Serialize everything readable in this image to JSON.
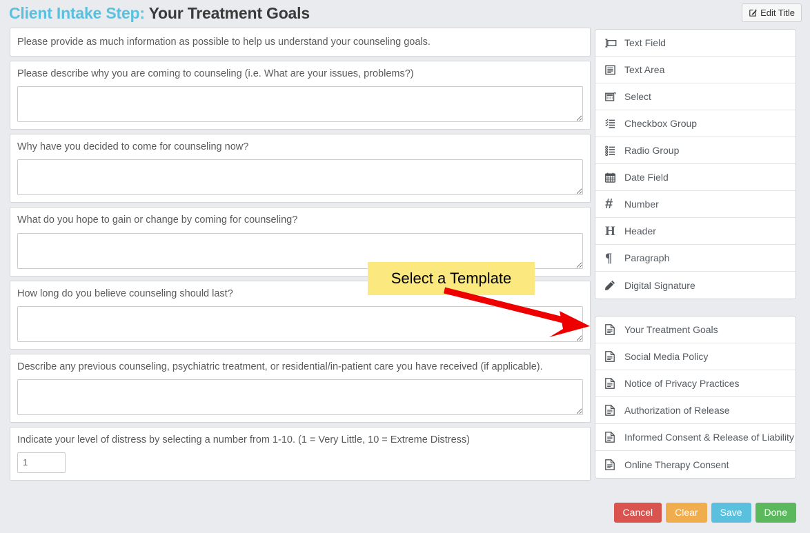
{
  "header": {
    "title_prefix": "Client Intake Step:",
    "title_name": "Your Treatment Goals",
    "edit_title_label": "Edit Title",
    "edit_title_icon": "edit-pencil-square-icon"
  },
  "form": {
    "intro_text": "Please provide as much information as possible to help us understand your counseling goals.",
    "questions": [
      {
        "label": "Please describe why you are coming to counseling (i.e. What are your issues, problems?)",
        "type": "textarea",
        "value": ""
      },
      {
        "label": "Why have you decided to come for counseling now?",
        "type": "textarea",
        "value": ""
      },
      {
        "label": "What do you hope to gain or change by coming for counseling?",
        "type": "textarea",
        "value": ""
      },
      {
        "label": "How long do you believe counseling should last?",
        "type": "textarea",
        "value": ""
      },
      {
        "label": "Describe any previous counseling, psychiatric treatment, or residential/in-patient care you have received (if applicable).",
        "type": "textarea",
        "value": ""
      },
      {
        "label": "Indicate your level of distress by selecting a number from 1-10.  (1 = Very Little, 10 = Extreme Distress)",
        "type": "number",
        "value": "1"
      }
    ]
  },
  "field_types": [
    {
      "label": "Text Field",
      "icon": "text-field-icon"
    },
    {
      "label": "Text Area",
      "icon": "text-area-icon"
    },
    {
      "label": "Select",
      "icon": "select-dropdown-icon"
    },
    {
      "label": "Checkbox Group",
      "icon": "checkbox-group-icon"
    },
    {
      "label": "Radio Group",
      "icon": "radio-group-icon"
    },
    {
      "label": "Date Field",
      "icon": "calendar-icon"
    },
    {
      "label": "Number",
      "icon": "hash-number-icon"
    },
    {
      "label": "Header",
      "icon": "header-h-icon"
    },
    {
      "label": "Paragraph",
      "icon": "paragraph-pilcrow-icon"
    },
    {
      "label": "Digital Signature",
      "icon": "pencil-signature-icon"
    }
  ],
  "templates": [
    {
      "label": "Your Treatment Goals",
      "icon": "document-icon"
    },
    {
      "label": "Social Media Policy",
      "icon": "document-icon"
    },
    {
      "label": "Notice of Privacy Practices",
      "icon": "document-icon"
    },
    {
      "label": "Authorization of Release",
      "icon": "document-icon"
    },
    {
      "label": "Informed Consent & Release of Liability",
      "icon": "document-icon"
    },
    {
      "label": "Online Therapy Consent",
      "icon": "document-icon"
    }
  ],
  "actions": [
    {
      "label": "Cancel",
      "color": "#d9534f"
    },
    {
      "label": "Clear",
      "color": "#f0ad4e"
    },
    {
      "label": "Save",
      "color": "#5bc0de"
    },
    {
      "label": "Done",
      "color": "#5cb85c"
    }
  ],
  "annotation": {
    "text": "Select a Template",
    "box_color": "#fbe87f",
    "arrow_color": "#ee0000"
  },
  "colors": {
    "background": "#e9ebee",
    "panel": "#ffffff",
    "title_accent": "#5bc0de",
    "title_text": "#3a3a3a",
    "label_text": "#5a5a5a"
  }
}
